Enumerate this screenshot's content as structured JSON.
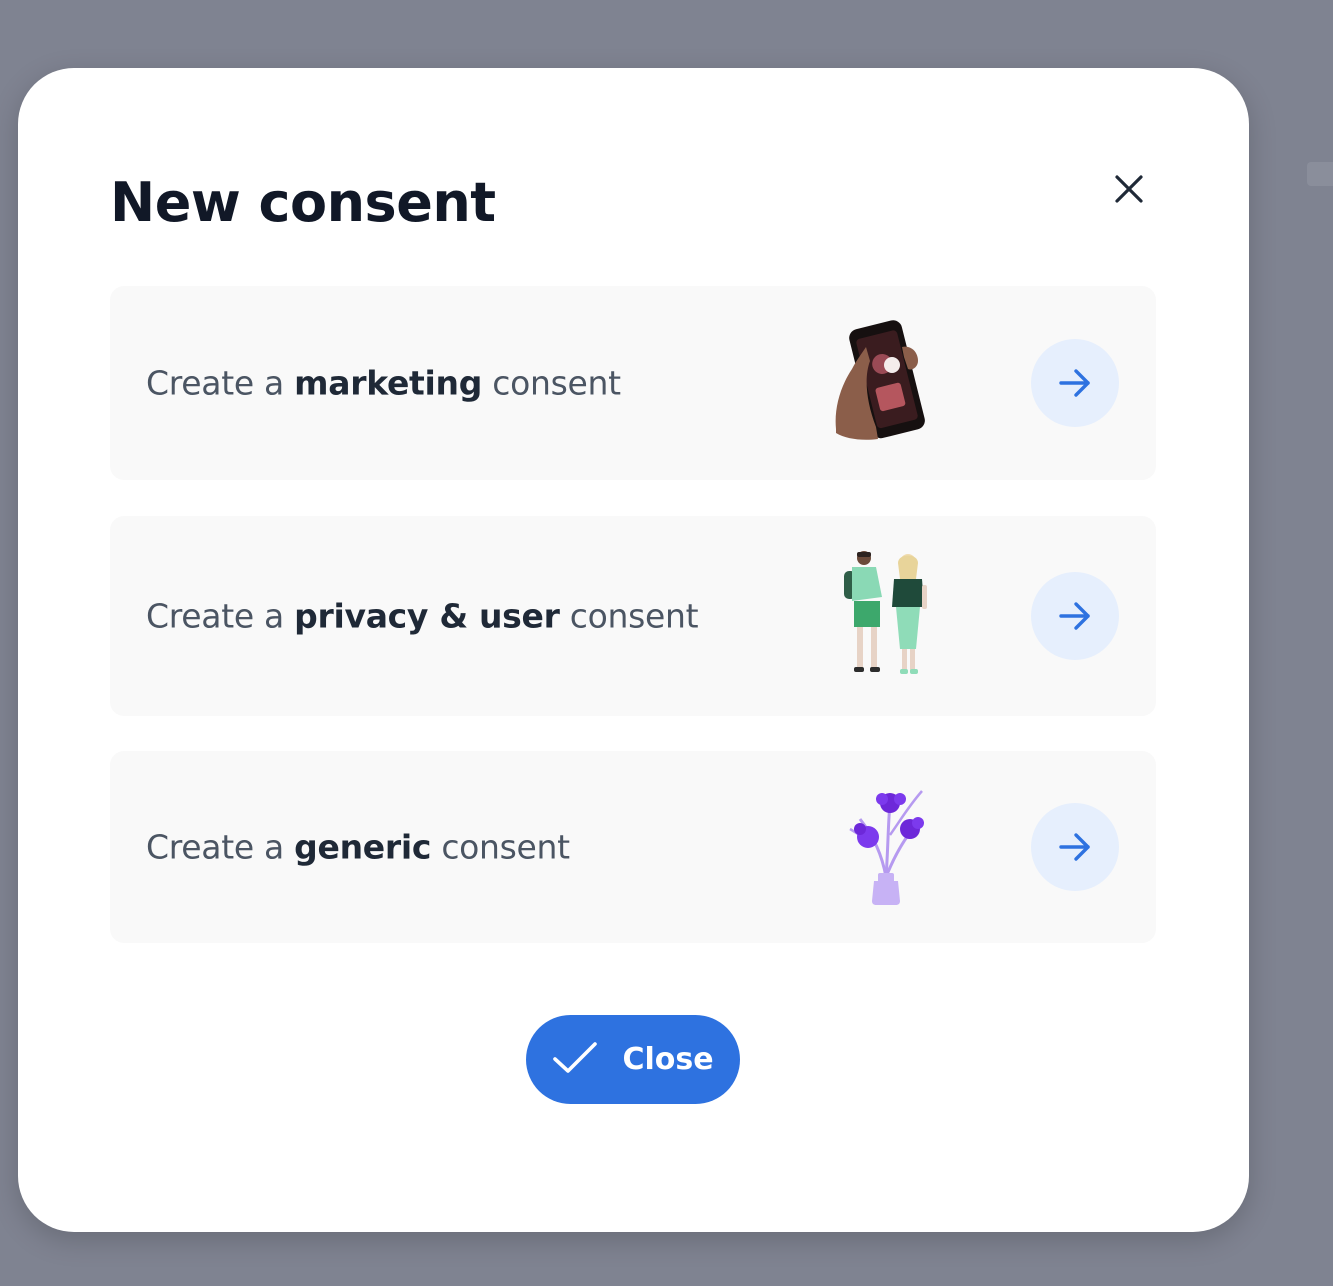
{
  "modal": {
    "title": "New consent",
    "options": [
      {
        "prefix": "Create a",
        "emphasis": "marketing",
        "suffix": "consent",
        "illustration": "hand-holding-phone-illustration",
        "action_icon": "arrow-right-icon"
      },
      {
        "prefix": "Create a",
        "emphasis": "privacy & user",
        "suffix": "consent",
        "illustration": "two-people-illustration",
        "action_icon": "arrow-right-icon"
      },
      {
        "prefix": "Create a",
        "emphasis": "generic",
        "suffix": "consent",
        "illustration": "flowers-vase-illustration",
        "action_icon": "arrow-right-icon"
      }
    ],
    "close_button": {
      "label": "Close",
      "icon": "checkmark-icon"
    },
    "dismiss_icon": "close-icon"
  },
  "colors": {
    "backdrop": "#7f8391",
    "primary": "#2e72e0",
    "arrow_bg": "#e6effd",
    "card_bg": "#f9f9f9",
    "title_text": "#111827"
  }
}
